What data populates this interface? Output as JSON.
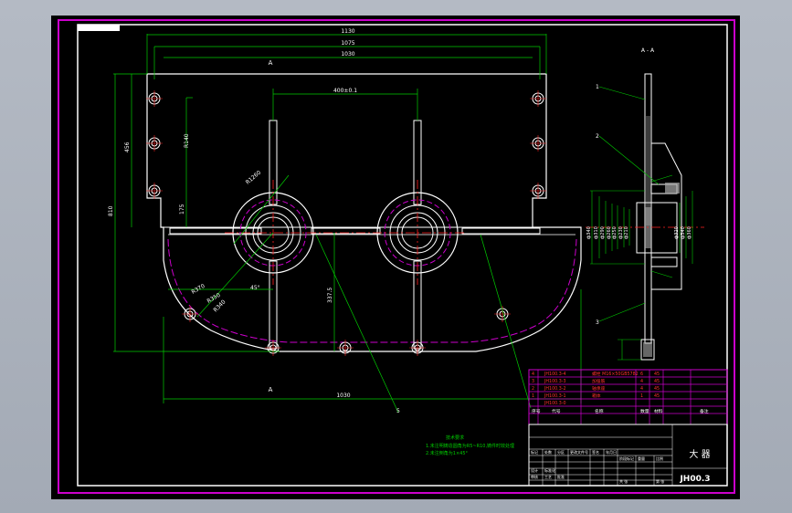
{
  "section_label": "A - A",
  "view_marks": {
    "top": "A",
    "bottom": "A"
  },
  "dims": {
    "width_total": "1130",
    "width_2": "1075",
    "width_3": "1030",
    "center_distance": "400±0.1",
    "bottom_width": "1030",
    "height_total": "810",
    "height_left": "456",
    "height_mid": "175",
    "height_right_small": "R140",
    "center_height": "337.5",
    "radius_outer": "R370",
    "radius_mid": "R350",
    "radius_inner": "R340",
    "angle": "45°",
    "r1": "R1260",
    "d_small": "ф260",
    "d_small2": "ф250",
    "d_small3": "ф230"
  },
  "side_dims": [
    "ф340",
    "ф310",
    "ф290",
    "ф260",
    "ф250",
    "ф230",
    "ф210",
    "ф190",
    "ф170"
  ],
  "side_dims_right": [
    "ф320",
    "ф340",
    "ф360"
  ],
  "callouts": [
    "1",
    "2",
    "3",
    "5"
  ],
  "tech_requirements": {
    "title": "技术要求",
    "lines": [
      "1.未注明铸造圆角为R5~R10,铸件时效处理",
      "2.未注倒角为1×45°"
    ]
  },
  "parts_table": {
    "rows": [
      {
        "no": "4",
        "code": "JH100.3-4",
        "name": "螺栓 M16×50GB5782",
        "qty": "6",
        "mat": "45"
      },
      {
        "no": "3",
        "code": "JH100.3-3",
        "name": "加强筋",
        "qty": "4",
        "mat": "45"
      },
      {
        "no": "2",
        "code": "JH100.3-2",
        "name": "轴承座",
        "qty": "4",
        "mat": "45"
      },
      {
        "no": "1",
        "code": "JH100.3-1",
        "name": "箱体",
        "qty": "1",
        "mat": "45"
      },
      {
        "no": "",
        "code": "JH100.3-0",
        "name": "",
        "qty": "",
        "mat": ""
      }
    ],
    "header": [
      "序号",
      "代号",
      "名称",
      "数量",
      "材料",
      "备注"
    ]
  },
  "title_block": {
    "title": "大 器",
    "drawing_no": "JH00.3",
    "labels": [
      "标记",
      "处数",
      "分区",
      "更改文件号",
      "签名",
      "年月日",
      "设计",
      "标准化",
      "阶段标记",
      "重量",
      "比例",
      "审核",
      "工艺",
      "批准",
      "共 张",
      "第 张"
    ]
  },
  "colors": {
    "frame": "#cc00cc",
    "outline": "#ffffff",
    "dimension": "#00cc00",
    "center_line": "#ff2020",
    "hidden": "#cc00cc",
    "background": "#000000"
  }
}
